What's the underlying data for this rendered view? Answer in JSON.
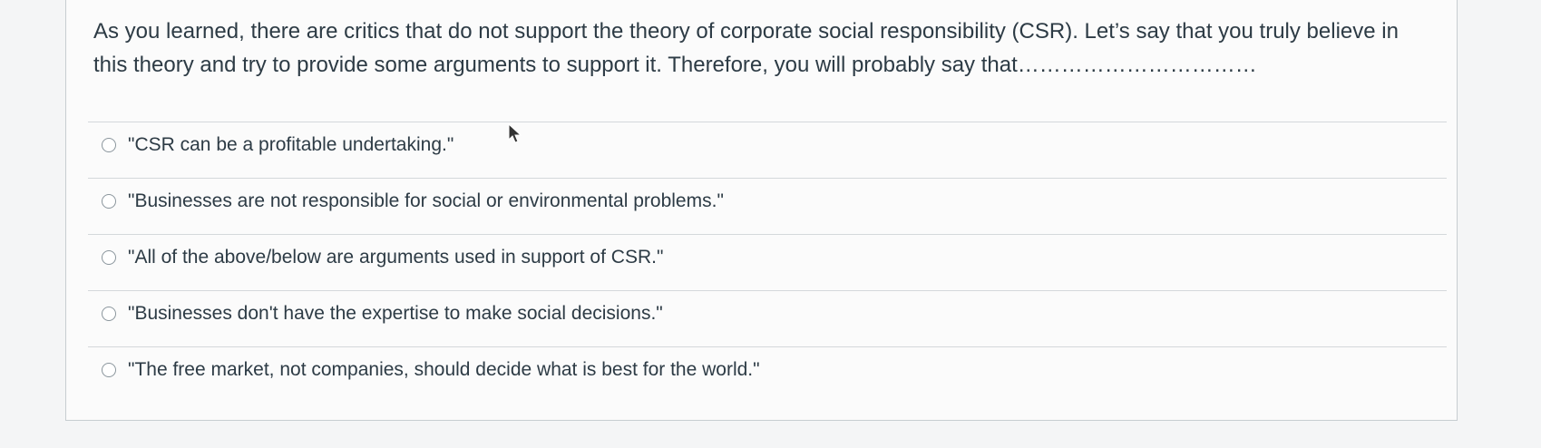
{
  "question": {
    "text": "As you learned, there are critics that do not support the theory of corporate social responsibility (CSR). Let’s say that you truly believe in this theory and try to provide some arguments to support it. Therefore, you will probably say that……………………………"
  },
  "answers": [
    {
      "label": "\"CSR can be a profitable undertaking.\""
    },
    {
      "label": "\"Businesses are not responsible for social or environmental problems.\""
    },
    {
      "label": "\"All of the above/below are arguments used in support of CSR.\""
    },
    {
      "label": "\"Businesses don't have the expertise to make social decisions.\""
    },
    {
      "label": "\"The free market, not companies, should decide what is best for the world.\""
    }
  ],
  "icons": {
    "radio": "radio-unselected-icon",
    "cursor": "mouse-pointer-icon"
  },
  "colors": {
    "text": "#2d3b45",
    "card_background": "#fbfbfb",
    "page_background": "#f4f5f6",
    "divider": "#d4d8db"
  }
}
